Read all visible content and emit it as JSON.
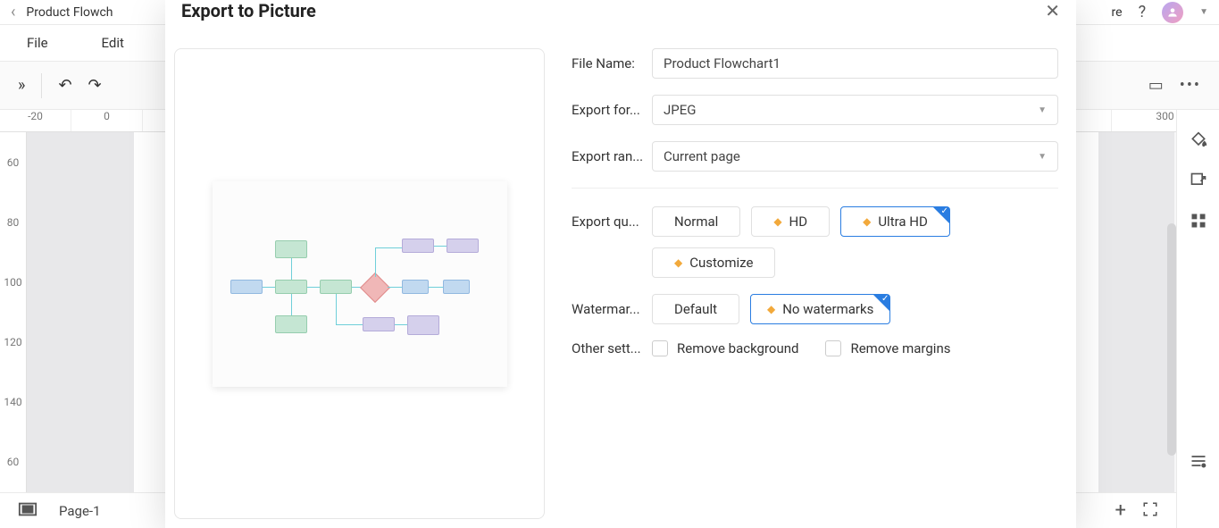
{
  "app": {
    "product_title": "Product Flowch",
    "share_partial": "re"
  },
  "menu": {
    "file": "File",
    "edit": "Edit"
  },
  "ruler_h": [
    "-20",
    "0",
    "300"
  ],
  "ruler_v": [
    "60",
    "80",
    "100",
    "120",
    "140",
    "60"
  ],
  "status": {
    "page": "Page-1"
  },
  "modal": {
    "title": "Export to Picture",
    "file_name_label": "File Name:",
    "file_name_value": "Product Flowchart1",
    "export_format_label": "Export for...",
    "export_format_value": "JPEG",
    "export_range_label": "Export ran...",
    "export_range_value": "Current page",
    "export_quality_label": "Export qu...",
    "quality_normal": "Normal",
    "quality_hd": "HD",
    "quality_ultra_hd": "Ultra HD",
    "quality_customize": "Customize",
    "watermark_label": "Watermar...",
    "watermark_default": "Default",
    "watermark_none": "No watermarks",
    "other_label": "Other sett...",
    "other_remove_bg": "Remove background",
    "other_remove_margins": "Remove margins"
  }
}
